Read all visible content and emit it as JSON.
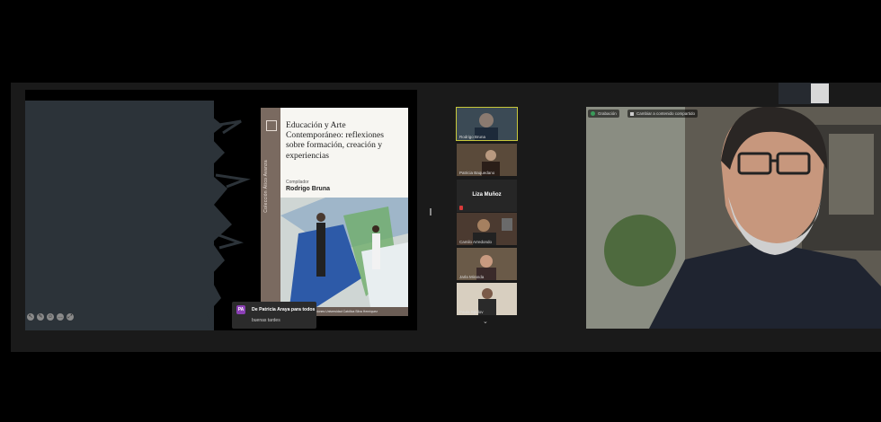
{
  "book": {
    "title": "Educación y Arte Contemporáneo: reflexiones sobre formación, creación y experiencias",
    "compiler_label": "Compilador",
    "author": "Rodrigo Bruna",
    "spine_text": "Colección Ático Avanza",
    "footer": "Ediciones Universidad Católica Silva Henríquez"
  },
  "chat_toast": {
    "avatar": "PA",
    "from": "De Patricia Araya para todos",
    "message": "buenas tardes"
  },
  "participants": [
    {
      "name": "Rodrigo Bruna",
      "active": true
    },
    {
      "name": "Patricia Baquedano"
    },
    {
      "name": "Liza Muñoz",
      "video": false
    },
    {
      "name": "Camilo Arredondo"
    },
    {
      "name": "Jarla Miranda"
    },
    {
      "name": "Paula Spidov"
    }
  ],
  "main_video": {
    "recording_label": "Grabación",
    "stop_share_label": "Cambiar a contenido compartido"
  },
  "icons": {
    "annotation_controls": [
      "pointer-icon",
      "pen-icon",
      "reaction-icon",
      "more-icon",
      "fullscreen-icon"
    ],
    "scroll": "chevron-down-icon"
  }
}
